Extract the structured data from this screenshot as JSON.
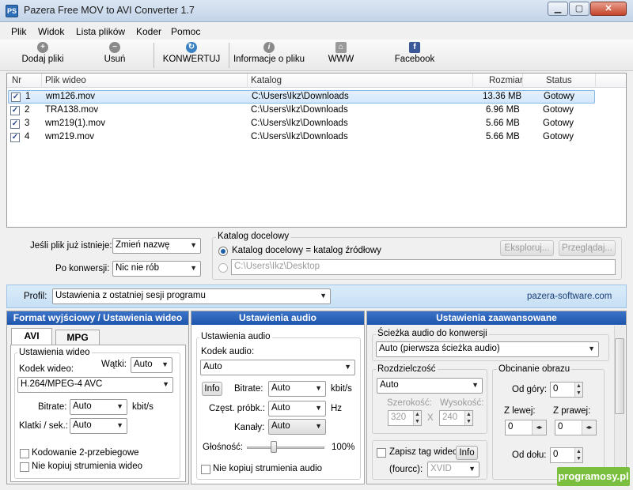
{
  "window": {
    "title": "Pazera Free MOV to AVI Converter 1.7",
    "icon": "PS"
  },
  "menu": [
    "Plik",
    "Widok",
    "Lista plików",
    "Koder",
    "Pomoc"
  ],
  "toolbar": {
    "add": "Dodaj pliki",
    "remove": "Usuń",
    "convert": "KONWERTUJ",
    "info": "Informacje o pliku",
    "www": "WWW",
    "facebook": "Facebook"
  },
  "list": {
    "columns": {
      "nr": "Nr",
      "file": "Plik wideo",
      "dir": "Katalog",
      "size": "Rozmiar",
      "status": "Status"
    },
    "rows": [
      {
        "nr": "1",
        "file": "wm126.mov",
        "dir": "C:\\Users\\Ikz\\Downloads",
        "size": "13.36 MB",
        "status": "Gotowy"
      },
      {
        "nr": "2",
        "file": "TRA138.mov",
        "dir": "C:\\Users\\Ikz\\Downloads",
        "size": "6.96 MB",
        "status": "Gotowy"
      },
      {
        "nr": "3",
        "file": "wm219(1).mov",
        "dir": "C:\\Users\\Ikz\\Downloads",
        "size": "5.66 MB",
        "status": "Gotowy"
      },
      {
        "nr": "4",
        "file": "wm219.mov",
        "dir": "C:\\Users\\Ikz\\Downloads",
        "size": "5.66 MB",
        "status": "Gotowy"
      }
    ]
  },
  "options": {
    "exists_label": "Jeśli plik już istnieje:",
    "exists_value": "Zmień nazwę",
    "after_label": "Po konwersji:",
    "after_value": "Nic nie rób",
    "target_group": "Katalog docelowy",
    "radio_same": "Katalog docelowy = katalog źródłowy",
    "target_path": "C:\\Users\\Ikz\\Desktop",
    "explore_btn": "Eksploruj...",
    "browse_btn": "Przeglądaj..."
  },
  "profile": {
    "label": "Profil:",
    "value": "Ustawienia z ostatniej sesji programu",
    "site": "pazera-software.com"
  },
  "video": {
    "title": "Format wyjściowy / Ustawienia wideo",
    "tab_avi": "AVI",
    "tab_mpg": "MPG",
    "group": "Ustawienia wideo",
    "codec_label": "Kodek wideo:",
    "threads_label": "Wątki:",
    "threads_value": "Auto",
    "codec_value": "H.264/MPEG-4 AVC",
    "bitrate_label": "Bitrate:",
    "bitrate_value": "Auto",
    "bitrate_unit": "kbit/s",
    "fps_label": "Klatki / sek.:",
    "fps_value": "Auto",
    "twopass": "Kodowanie 2-przebiegowe",
    "nocopy": "Nie kopiuj strumienia wideo"
  },
  "audio": {
    "title": "Ustawienia audio",
    "group": "Ustawienia audio",
    "codec_label": "Kodek audio:",
    "codec_value": "Auto",
    "info_btn": "Info",
    "bitrate_label": "Bitrate:",
    "bitrate_value": "Auto",
    "bitrate_unit": "kbit/s",
    "freq_label": "Częst. próbk.:",
    "freq_value": "Auto",
    "freq_unit": "Hz",
    "channels_label": "Kanały:",
    "channels_value": "Auto",
    "volume_label": "Głośność:",
    "volume_value": "100%",
    "nocopy": "Nie kopiuj strumienia audio"
  },
  "advanced": {
    "title": "Ustawienia zaawansowane",
    "track_group": "Ścieżka audio do konwersji",
    "track_value": "Auto (pierwsza ścieżka audio)",
    "res_group": "Rozdzielczość",
    "res_value": "Auto",
    "width_label": "Szerokość:",
    "height_label": "Wysokość:",
    "width_value": "320",
    "height_value": "240",
    "x": "X",
    "crop_group": "Obcinanie obrazu",
    "top_label": "Od góry:",
    "top_value": "0",
    "left_label": "Z lewej:",
    "left_value": "0",
    "right_label": "Z prawej:",
    "right_value": "0",
    "bottom_label": "Od dołu:",
    "bottom_value": "0",
    "fourcc_chk": "Zapisz tag wideo",
    "info_btn": "Info",
    "fourcc_label": "(fourcc):",
    "fourcc_value": "XVID"
  },
  "watermark": "programosy.pl"
}
